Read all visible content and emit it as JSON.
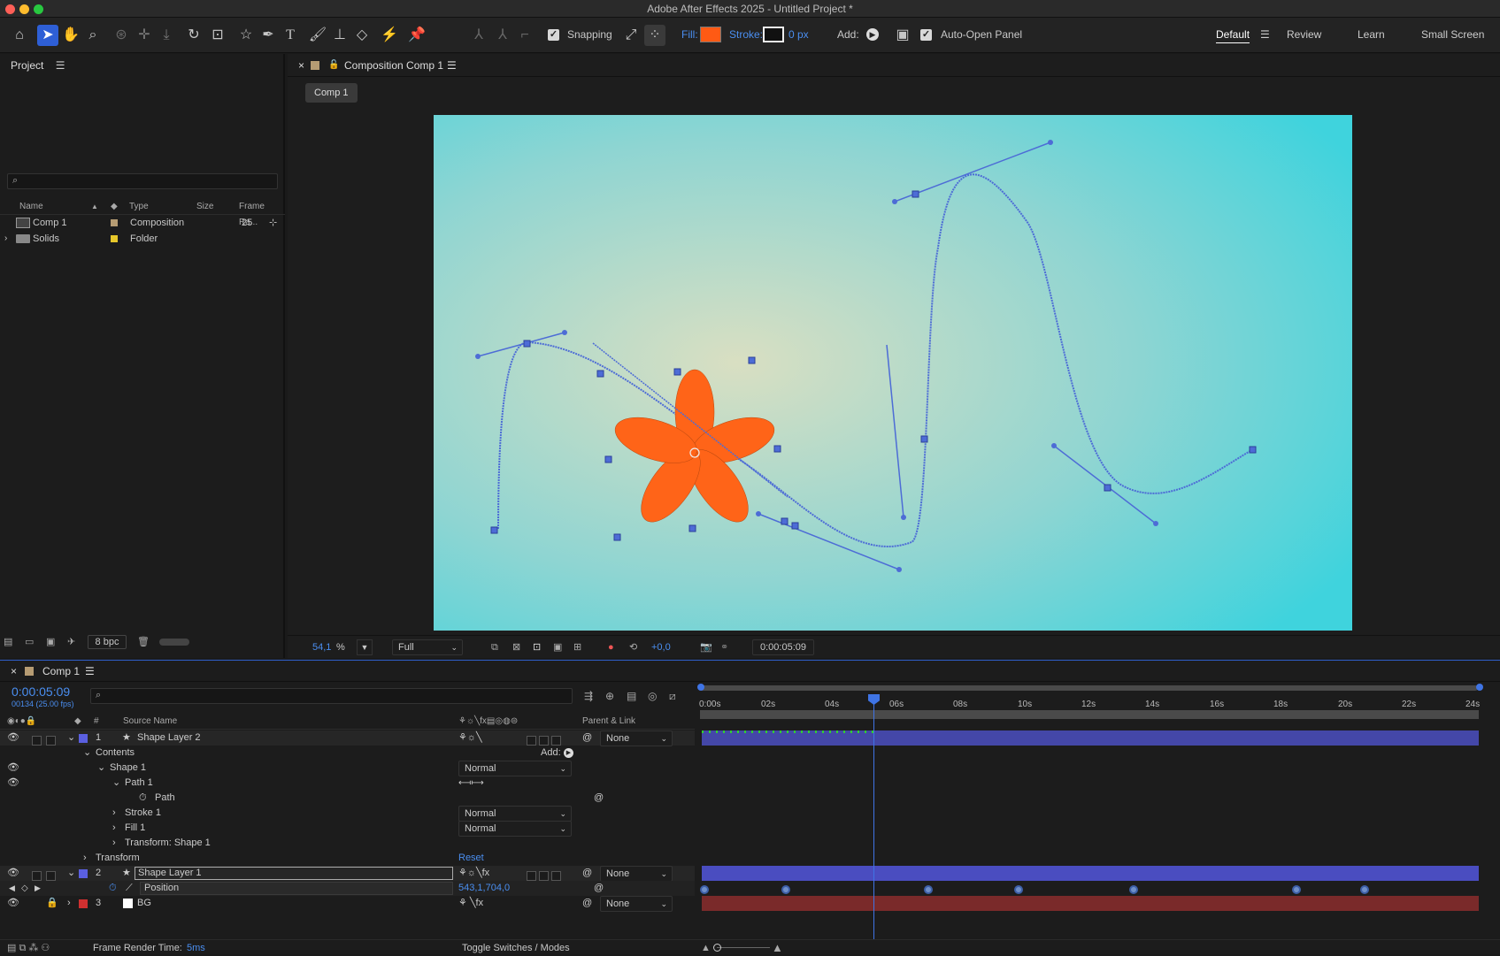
{
  "window": {
    "title": "Adobe After Effects 2025 - Untitled Project *"
  },
  "toolbar": {
    "tools": [
      "home-icon",
      "selection-tool-icon",
      "hand-tool-icon",
      "zoom-tool-icon",
      "orbit-camera-icon",
      "pan-camera-icon",
      "dolly-camera-icon",
      "rotation-tool-icon",
      "pan-behind-icon",
      "star-shape-icon",
      "pen-tool-icon",
      "type-tool-icon",
      "brush-tool-icon",
      "clone-stamp-icon",
      "eraser-tool-icon",
      "roto-brush-icon",
      "puppet-pin-icon"
    ],
    "snapping_label": "Snapping",
    "fill_label": "Fill:",
    "fill_color": "#ff5a14",
    "stroke_label": "Stroke:",
    "stroke_value": "0 px",
    "add_label": "Add:",
    "auto_open_label": "Auto-Open Panel"
  },
  "workspaces": {
    "items": [
      "Default",
      "Review",
      "Learn",
      "Small Screen"
    ],
    "active": "Default"
  },
  "project": {
    "title": "Project",
    "search_placeholder": "",
    "columns": [
      "Name",
      "Type",
      "Size",
      "Frame Ra..."
    ],
    "items": [
      {
        "name": "Comp 1",
        "type": "Composition",
        "size": "",
        "fps": "25",
        "label_color": "#b69c73"
      },
      {
        "name": "Solids",
        "type": "Folder",
        "size": "",
        "fps": "",
        "label_color": "#e6c72a"
      }
    ],
    "bpc": "8 bpc"
  },
  "composition": {
    "tab_title": "Composition Comp 1",
    "breadcrumb": "Comp 1",
    "zoom": "54,1",
    "zoom_unit": "%",
    "resolution": "Full",
    "exposure": "+0,0",
    "timecode": "0:00:05:09",
    "bg_color_center": "#d9dfc2",
    "bg_color_edge": "#3fd3dd",
    "shape_color": "#ff6418",
    "path_color": "#4d6cd6"
  },
  "timeline": {
    "tab_title": "Comp 1",
    "timecode": "0:00:05:09",
    "frame_info": "00134 (25.00 fps)",
    "columns": {
      "num": "#",
      "source": "Source Name",
      "parent": "Parent & Link"
    },
    "ruler": [
      "0:00s",
      "02s",
      "04s",
      "06s",
      "08s",
      "10s",
      "12s",
      "14s",
      "16s",
      "18s",
      "20s",
      "22s",
      "24s"
    ],
    "layers": [
      {
        "num": "1",
        "name": "Shape Layer 2",
        "label_color": "#5a5fe0",
        "parent": "None"
      },
      {
        "num": "2",
        "name": "Shape Layer 1",
        "label_color": "#5a5fe0",
        "parent": "None"
      },
      {
        "num": "3",
        "name": "BG",
        "label_color": "#d03030",
        "parent": "None"
      }
    ],
    "props": {
      "contents": "Contents",
      "add_label": "Add:",
      "shape1": "Shape 1",
      "path1": "Path 1",
      "path": "Path",
      "stroke1": "Stroke 1",
      "fill1": "Fill 1",
      "transform_shape": "Transform: Shape 1",
      "transform": "Transform",
      "reset": "Reset",
      "position": "Position",
      "position_value": "543,1,704,0",
      "blend_normal": "Normal"
    },
    "frame_render_label": "Frame Render Time:",
    "frame_render_value": "5ms",
    "toggle_label": "Toggle Switches / Modes"
  }
}
